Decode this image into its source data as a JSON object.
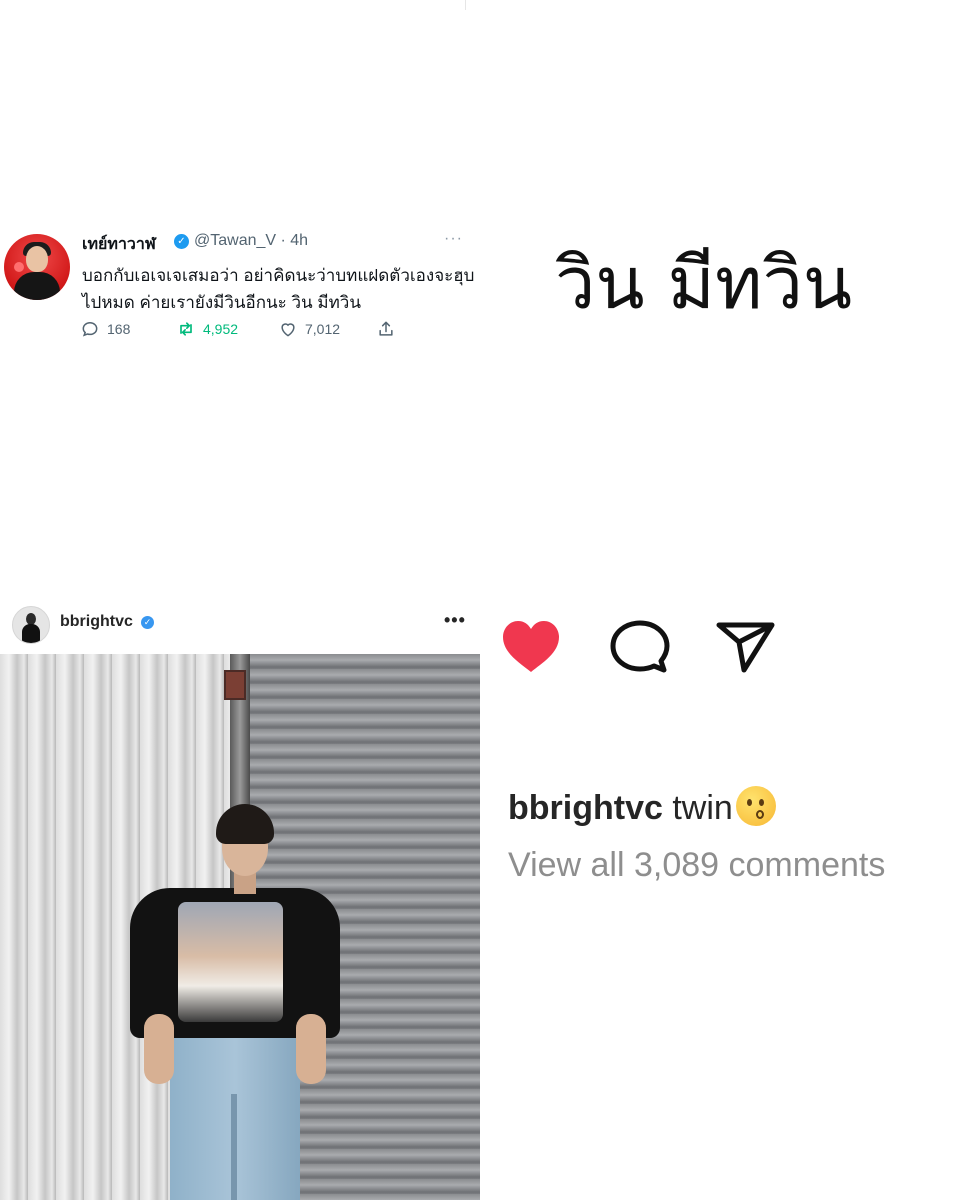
{
  "tweet": {
    "name": "เทย์ทาวาฬ",
    "handle_time": "@Tawan_V · 4h",
    "text": "บอกกับเอเจเจเสมอว่า อย่าคิดนะว่าบทแฝดตัวเองจะฮุบไปหมด ค่ายเรายังมีวินอีกนะ วิน มีทวิน",
    "more": "···",
    "replies": "168",
    "retweets": "4,952",
    "likes": "7,012",
    "colors": {
      "retweet": "#00ba7c",
      "verified": "#1d9bf0"
    }
  },
  "big_text": "วิน มีทวิน",
  "instagram": {
    "username": "bbrightvc",
    "more": "•••",
    "caption_user": "bbrightvc",
    "caption_text": "twin",
    "caption_emoji": "kissing-face-emoji",
    "view_comments": "View all 3,089 comments",
    "icons": [
      "heart-icon",
      "comment-icon",
      "share-icon"
    ],
    "colors": {
      "like": "#f0374f",
      "verified": "#3897f0"
    }
  }
}
